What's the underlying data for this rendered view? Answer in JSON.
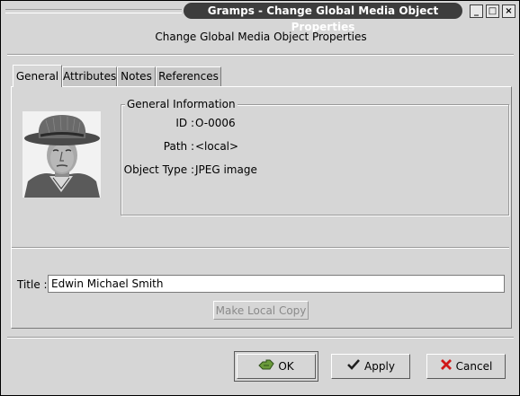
{
  "window": {
    "title": "Gramps - Change Global Media Object Properties",
    "controls": [
      "minimize",
      "maximize",
      "close"
    ]
  },
  "header": {
    "text": "Change Global Media Object Properties"
  },
  "tabs": [
    {
      "label": "General",
      "active": true
    },
    {
      "label": "Attributes",
      "active": false
    },
    {
      "label": "Notes",
      "active": false
    },
    {
      "label": "References",
      "active": false
    }
  ],
  "general_info": {
    "frame_label": "General Information",
    "id_label": "ID :",
    "id_value": "O-0006",
    "path_label": "Path :",
    "path_value": "<local>",
    "type_label": "Object Type :",
    "type_value": "JPEG image"
  },
  "title_field": {
    "label": "Title :",
    "value": "Edwin Michael Smith"
  },
  "make_local_copy": {
    "label": "Make Local Copy",
    "enabled": false
  },
  "buttons": {
    "ok": "OK",
    "apply": "Apply",
    "cancel": "Cancel"
  },
  "icons": {
    "ok": "ok-hand-icon",
    "apply": "checkmark-icon",
    "cancel": "red-x-icon"
  }
}
